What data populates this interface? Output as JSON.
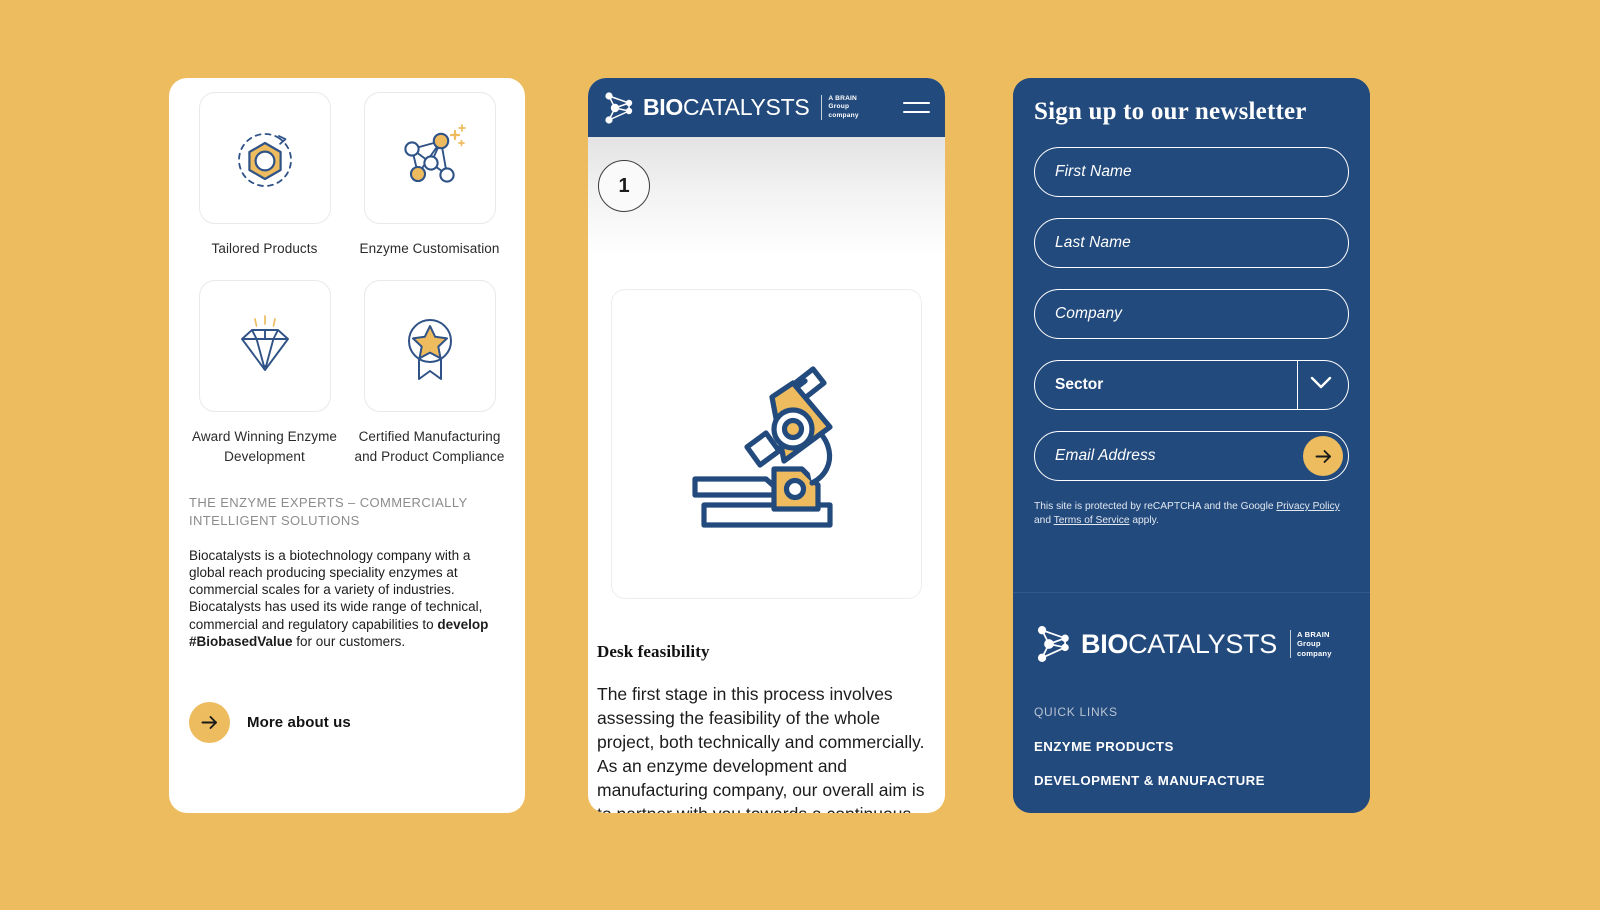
{
  "colors": {
    "page_background": "#edbc5f",
    "brand_navy": "#234a7d",
    "brand_gold": "#edbc5f",
    "card_white": "#ffffff"
  },
  "left_panel": {
    "features": [
      {
        "icon": "hexagon-refresh-icon",
        "label": "Tailored Products"
      },
      {
        "icon": "molecule-network-sparkle-icon",
        "label": "Enzyme Customisation"
      },
      {
        "icon": "diamond-icon",
        "label": "Award Winning Enzyme Development"
      },
      {
        "icon": "award-ribbon-star-icon",
        "label": "Certified Manufacturing and Product Compliance"
      }
    ],
    "eyebrow": "THE ENZYME EXPERTS – COMMERCIALLY INTELLIGENT SOLUTIONS",
    "paragraph_lead": "Biocatalysts is a biotechnology company with a global reach producing speciality enzymes at commercial scales for a variety of industries. Biocatalysts has used its wide range of technical, commercial and regulatory capabilities to ",
    "paragraph_bold": "develop #BiobasedValue",
    "paragraph_tail": " for our customers.",
    "cta_label": "More about us",
    "cta_icon": "arrow-right-icon"
  },
  "mid_panel": {
    "header": {
      "logo_bold": "BIO",
      "logo_light": "CATALYSTS",
      "logo_tag_line1": "A BRAIN",
      "logo_tag_line2": "Group",
      "logo_tag_line3": "company",
      "logo_mark": "molecule-logo-icon",
      "menu_icon": "hamburger-menu-icon"
    },
    "step_number": "1",
    "hero_icon": "microscope-icon",
    "article_title": "Desk feasibility",
    "article_body": "The first stage in this process involves assessing the feasibility of the whole project, both technically and commercially. As an enzyme development and manufacturing company, our overall aim is to partner with you towards a continuous supply of your desired novel enzyme at the right price."
  },
  "right_panel": {
    "newsletter": {
      "title": "Sign up to our newsletter",
      "first_name_placeholder": "First Name",
      "last_name_placeholder": "Last Name",
      "company_placeholder": "Company",
      "sector_value": "Sector",
      "sector_icon": "chevron-down-icon",
      "email_placeholder": "Email Address",
      "submit_icon": "arrow-right-icon",
      "legal_prefix": "This site is protected by reCAPTCHA and the Google ",
      "legal_link1": "Privacy Policy",
      "legal_mid": " and ",
      "legal_link2": "Terms of Service",
      "legal_suffix": " apply."
    },
    "footer": {
      "logo_bold": "BIO",
      "logo_light": "CATALYSTS",
      "logo_tag_line1": "A BRAIN",
      "logo_tag_line2": "Group",
      "logo_tag_line3": "company",
      "logo_mark": "molecule-logo-icon",
      "quick_links_label": "QUICK LINKS",
      "links": [
        "ENZYME PRODUCTS",
        "DEVELOPMENT & MANUFACTURE"
      ]
    }
  }
}
